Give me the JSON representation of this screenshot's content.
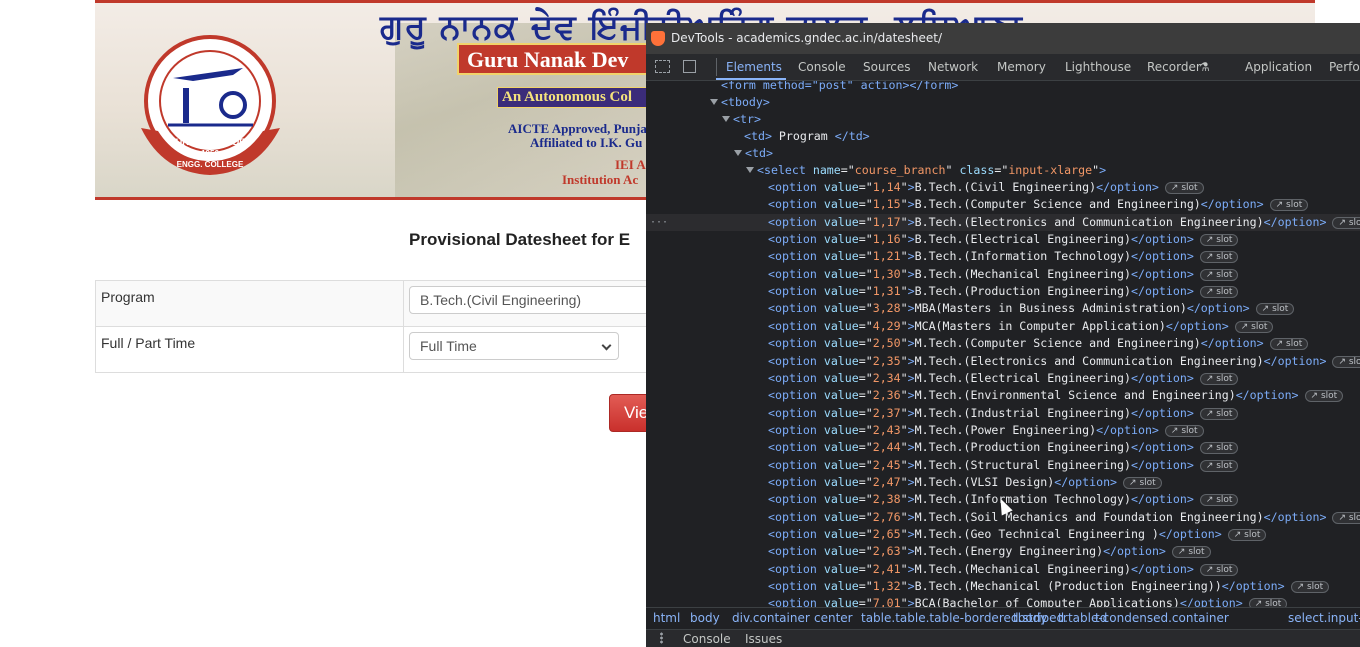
{
  "page": {
    "banner": {
      "punjabi_title": "ਗੁਰੂ ਨਾਨਕ ਦੇਵ ਇੰਜੀਨੀਅਰਿੰਗ ਕਾਲਜ, ਲੁਧਿਆਣਾ",
      "college_name": "Guru Nanak Dev",
      "autonomous": "An Autonomous Col",
      "aicte": "AICTE Approved, Punja",
      "affiliated": "Affiliated to I.K. Gu",
      "iei": "IEI A",
      "institution": "Institution Ac",
      "logo_top": "GURU NANAK DEV",
      "logo_year": "1956",
      "logo_bottom": "ENGG. COLLEGE"
    },
    "heading": "Provisional Datesheet for E",
    "form": {
      "program_label": "Program",
      "program_value": "B.Tech.(Civil Engineering)",
      "time_label": "Full / Part Time",
      "time_value": "Full Time"
    },
    "view_button": "Vie"
  },
  "devtools": {
    "title": "DevTools - academics.gndec.ac.in/datesheet/",
    "tabs": [
      "Elements",
      "Console",
      "Sources",
      "Network",
      "Memory",
      "Lighthouse",
      "Recorder",
      "Application",
      "Perfor"
    ],
    "active_tab": "Elements",
    "slot_label": "slot",
    "tree": {
      "form_line": "<form method=\"post\" action></form>",
      "tbody": "tbody",
      "tr": "tr",
      "td_program": "Program",
      "td": "td",
      "select_name": "course_branch",
      "select_class": "input-xlarge",
      "options": [
        {
          "value": "1,14",
          "text": "B.Tech.(Civil Engineering)"
        },
        {
          "value": "1,15",
          "text": "B.Tech.(Computer Science and Engineering)"
        },
        {
          "value": "1,17",
          "text": "B.Tech.(Electronics and Communication Engineering)"
        },
        {
          "value": "1,16",
          "text": "B.Tech.(Electrical Engineering)"
        },
        {
          "value": "1,21",
          "text": "B.Tech.(Information Technology)"
        },
        {
          "value": "1,30",
          "text": "B.Tech.(Mechanical Engineering)"
        },
        {
          "value": "1,31",
          "text": "B.Tech.(Production Engineering)"
        },
        {
          "value": "3,28",
          "text": "MBA(Masters in Business Administration)"
        },
        {
          "value": "4,29",
          "text": "MCA(Masters in Computer Application)"
        },
        {
          "value": "2,50",
          "text": "M.Tech.(Computer Science and Engineering)"
        },
        {
          "value": "2,35",
          "text": "M.Tech.(Electronics and Communication Engineering)"
        },
        {
          "value": "2,34",
          "text": "M.Tech.(Electrical Engineering)"
        },
        {
          "value": "2,36",
          "text": "M.Tech.(Environmental Science and Engineering)"
        },
        {
          "value": "2,37",
          "text": "M.Tech.(Industrial Engineering)"
        },
        {
          "value": "2,43",
          "text": "M.Tech.(Power Engineering)"
        },
        {
          "value": "2,44",
          "text": "M.Tech.(Production Engineering)"
        },
        {
          "value": "2,45",
          "text": "M.Tech.(Structural Engineering)"
        },
        {
          "value": "2,47",
          "text": "M.Tech.(VLSI Design)"
        },
        {
          "value": "2,38",
          "text": "M.Tech.(Information Technology)"
        },
        {
          "value": "2,76",
          "text": "M.Tech.(Soil Mechanics and Foundation Engineering)"
        },
        {
          "value": "2,65",
          "text": "M.Tech.(Geo Technical Engineering )"
        },
        {
          "value": "2,63",
          "text": "M.Tech.(Energy Engineering)"
        },
        {
          "value": "2,41",
          "text": "M.Tech.(Mechanical Engineering)"
        },
        {
          "value": "1,32",
          "text": "B.Tech.(Mechanical (Production Engineering))"
        },
        {
          "value": "7,01",
          "text": "BCA(Bachelor of Computer Applications)"
        }
      ]
    },
    "breadcrumbs": [
      "html",
      "body",
      "div.container",
      "center",
      "table.table.table-bordered.striped.table-condensed.container",
      "tbody",
      "tr",
      "td",
      "select.input-x"
    ],
    "drawer_tabs": [
      "Console",
      "Issues"
    ]
  }
}
